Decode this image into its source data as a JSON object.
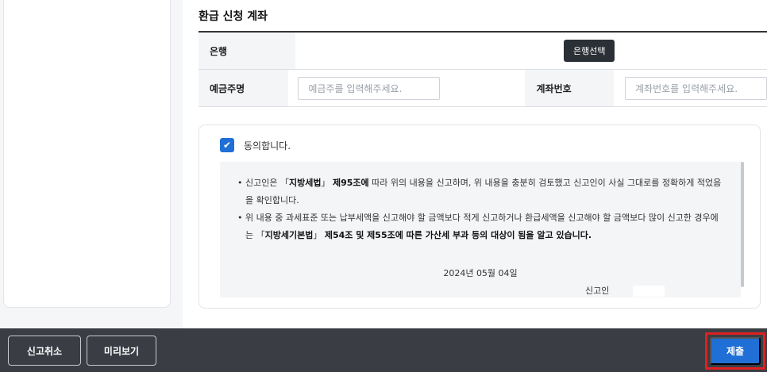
{
  "section": {
    "title": "환급 신청 계좌"
  },
  "account": {
    "bank_label": "은행",
    "bank_button": "은행선택",
    "depositor_label": "예금주명",
    "depositor_placeholder": "예금주를 입력해주세요.",
    "account_label": "계좌번호",
    "account_placeholder": "계좌번호를 입력해주세요."
  },
  "agreement": {
    "checked": true,
    "label": "동의합니다.",
    "check_icon": "check-icon",
    "notice1_pre": "• 신고인은 「",
    "notice1_bold1": "지방세법",
    "notice1_mid": "」 ",
    "notice1_bold2": "제95조에",
    "notice1_post": " 따라 위의 내용을 신고하며, 위 내용을 충분히 검토했고 신고인이 사실 그대로를 정확하게 적었음을 확인합니다.",
    "notice2_pre": "• 위 내용 중 과세표준 또는 납부세액을 신고해야 할 금액보다 적게 신고하거나 환급세액을 신고해야 할 금액보다 많이 신고한 경우에는 「",
    "notice2_bold1": "지방세기본법",
    "notice2_mid": "」 ",
    "notice2_bold2": "제54조 및 제55조에 따른 가산세 부과 등의 대상이 됨을 알고 있습니다.",
    "date": "2024년 05월 04일",
    "signer_label": "신고인"
  },
  "footer": {
    "cancel": "신고취소",
    "preview": "미리보기",
    "submit": "제출"
  }
}
